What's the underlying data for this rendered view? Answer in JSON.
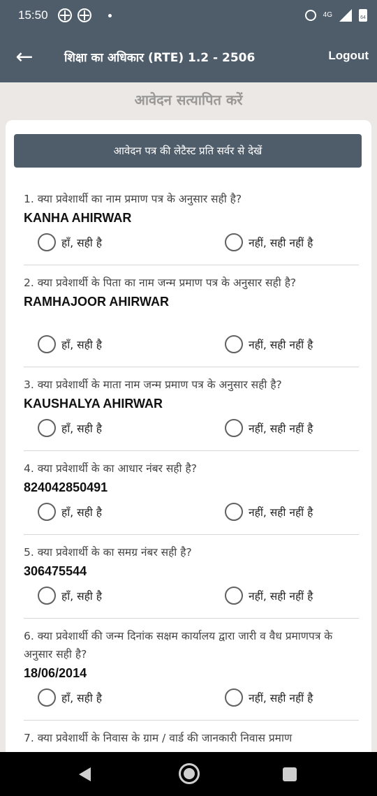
{
  "status_bar": {
    "time": "15:50",
    "network": "4G",
    "battery": "64",
    "icons": [
      "notification-icon",
      "notification-icon",
      "alarm-icon",
      "signal-icon",
      "battery-icon"
    ]
  },
  "app_bar": {
    "back_icon": "arrow-left-icon",
    "title": "शिक्षा का अधिकार (RTE) 1.2 - 2506",
    "logout_label": "Logout"
  },
  "page": {
    "heading": "आवेदन सत्यापित करें",
    "view_latest_label": "आवेदन पत्र की लेटैस्ट प्रति सर्वर से देखें"
  },
  "options": {
    "yes_label": "हाँ, सही है",
    "no_label": "नहीं, सही नहीं है"
  },
  "questions": [
    {
      "text": "1. क्या प्रवेशार्थी का नाम प्रमाण पत्र के अनुसार सही है?",
      "answer": "KANHA AHIRWAR"
    },
    {
      "text": "2. क्या प्रवेशार्थी के पिता का  नाम जन्म प्रमाण पत्र के अनुसार सही है?",
      "answer": "RAMHAJOOR AHIRWAR"
    },
    {
      "text": "3. क्या प्रवेशार्थी के माता नाम जन्म प्रमाण पत्र के अनुसार सही है?",
      "answer": "KAUSHALYA AHIRWAR"
    },
    {
      "text": "4. क्या प्रवेशार्थी के का आधार नंबर सही है?",
      "answer": "824042850491"
    },
    {
      "text": "5. क्या प्रवेशार्थी के का समग्र नंबर सही है?",
      "answer": "306475544"
    },
    {
      "text": "6. क्या प्रवेशार्थी की जन्म दिनांक सक्षम कार्यालय द्वारा जारी व वैध प्रमाणपत्र के अनुसार सही है?",
      "answer": "18/06/2014"
    },
    {
      "text": "7. क्या प्रवेशार्थी के  निवास के ग्राम / वार्ड की जानकारी निवास प्रमाण",
      "answer": ""
    }
  ]
}
